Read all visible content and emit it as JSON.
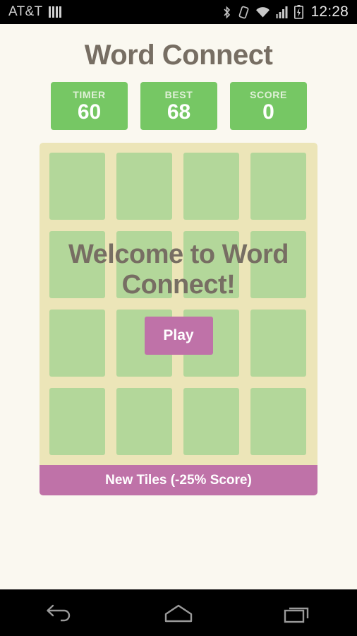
{
  "status_bar": {
    "carrier": "AT&T",
    "time": "12:28",
    "icons": [
      "signal-bars-icon",
      "bluetooth-icon",
      "vibrate-icon",
      "wifi-icon",
      "cell-signal-icon",
      "battery-charging-icon"
    ]
  },
  "app": {
    "title": "Word Connect",
    "background_color": "#faf8f0",
    "title_color": "#776e63",
    "accent_green": "#76c764",
    "accent_pink": "#bf72a8",
    "board_color": "#ece5b8",
    "tile_color": "#b3d79a"
  },
  "scores": [
    {
      "label": "TIMER",
      "value": "60"
    },
    {
      "label": "BEST",
      "value": "68"
    },
    {
      "label": "SCORE",
      "value": "0"
    }
  ],
  "board": {
    "rows": 4,
    "cols": 4,
    "tiles": [
      "",
      "",
      "",
      "",
      "",
      "",
      "",
      "",
      "",
      "",
      "",
      "",
      "",
      "",
      "",
      ""
    ]
  },
  "new_tiles_button": {
    "label": "New Tiles (-25% Score)"
  },
  "overlay": {
    "message": "Welcome to Word Connect!",
    "play_label": "Play"
  },
  "nav_bar": {
    "back": "back-icon",
    "home": "home-icon",
    "recents": "recents-icon"
  }
}
